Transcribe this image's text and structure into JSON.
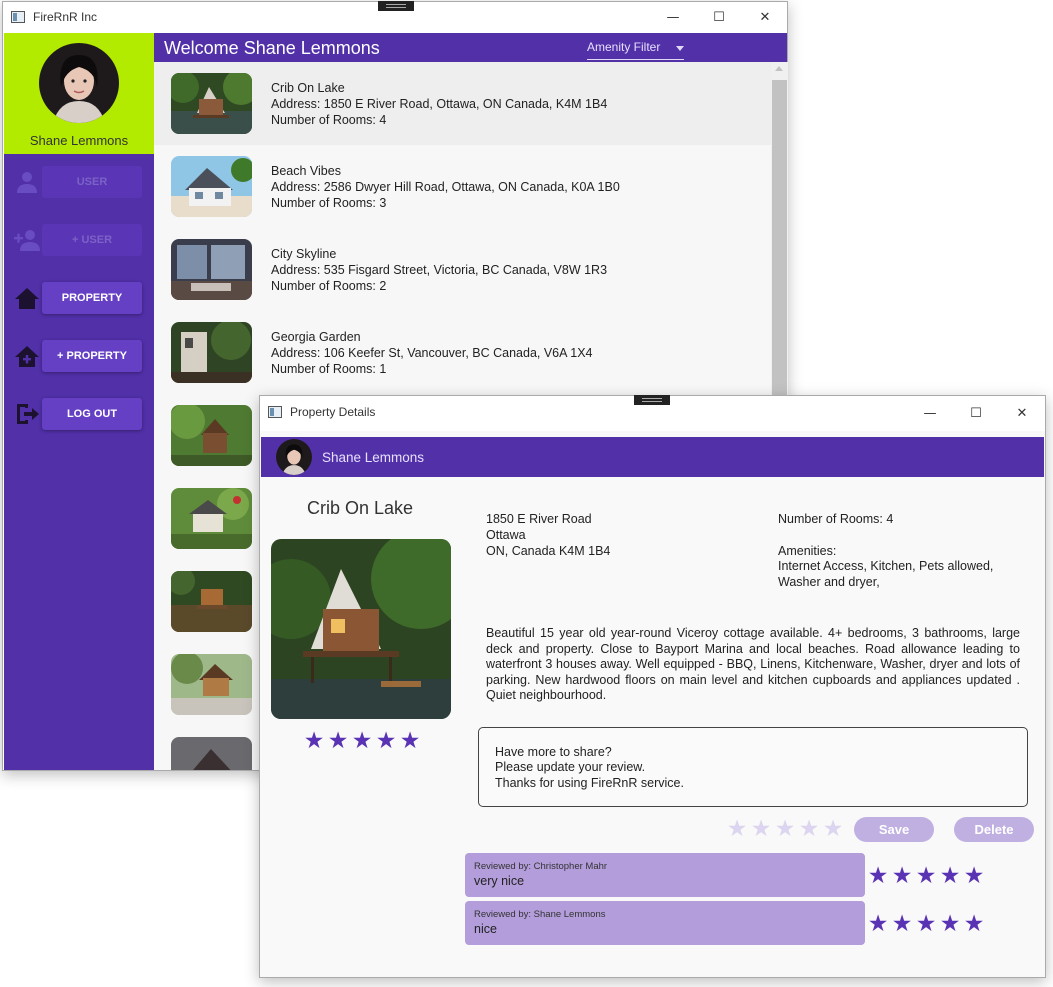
{
  "main_window": {
    "title": "FireRnR Inc",
    "welcome": "Welcome Shane Lemmons",
    "amenity_filter": {
      "selected": "Amenity Filter"
    }
  },
  "sidebar": {
    "user_name": "Shane Lemmons",
    "items": [
      {
        "label": "USER",
        "icon": "person-icon",
        "enabled": false
      },
      {
        "label": "+ USER",
        "icon": "add-person-icon",
        "enabled": false
      },
      {
        "label": "PROPERTY",
        "icon": "home-icon",
        "enabled": true
      },
      {
        "label": "+ PROPERTY",
        "icon": "add-home-icon",
        "enabled": true
      },
      {
        "label": "LOG OUT",
        "icon": "logout-icon",
        "enabled": true
      }
    ]
  },
  "properties": [
    {
      "name": "Crib On Lake",
      "address": "Address: 1850 E River Road, Ottawa, ON Canada, K4M 1B4",
      "rooms": "Number of Rooms: 4"
    },
    {
      "name": "Beach Vibes",
      "address": "Address: 2586  Dwyer Hill Road, Ottawa, ON Canada, K0A 1B0",
      "rooms": "Number of Rooms: 3"
    },
    {
      "name": "City Skyline",
      "address": "Address: 535  Fisgard Street, Victoria, BC Canada, V8W 1R3",
      "rooms": "Number of Rooms: 2"
    },
    {
      "name": "Georgia Garden",
      "address": "Address: 106 Keefer St, Vancouver, BC Canada, V6A 1X4",
      "rooms": "Number of Rooms: 1"
    }
  ],
  "details": {
    "window_title": "Property Details",
    "user_name": "Shane Lemmons",
    "property_name": "Crib On Lake",
    "property_rating": 5,
    "address_line1": "1850 E River Road",
    "address_line2": "Ottawa",
    "address_line3": "ON, Canada K4M 1B4",
    "rooms": "Number of Rooms: 4",
    "amenities_label": "Amenities:",
    "amenities_line1": "Internet Access, Kitchen, Pets allowed,",
    "amenities_line2": "Washer and dryer,",
    "description": "Beautiful 15 year old year-round Viceroy cottage available. 4+ bedrooms, 3 bathrooms, large deck and property. Close to Bayport Marina and local beaches. Road allowance leading to waterfront 3 houses away. Well equipped - BBQ, Linens, Kitchenware, Washer, dryer and lots of parking. New hardwood floors on main level and kitchen cupboards and appliances updated . Quiet neighbourhood.",
    "review_prompt_line1": "Have more to share?",
    "review_prompt_line2": "Please update your review.",
    "review_prompt_line3": "Thanks for using FireRnR service.",
    "my_rating": 0,
    "save_label": "Save",
    "delete_label": "Delete",
    "reviews": [
      {
        "by": "Reviewed by: Christopher Mahr",
        "text": "very nice",
        "rating": 5
      },
      {
        "by": "Reviewed by: Shane Lemmons",
        "text": "nice",
        "rating": 5
      }
    ]
  },
  "colors": {
    "primary": "#5130a8",
    "accent": "#b2ea00",
    "button": "#6540c4",
    "star": "#5a33b4",
    "review_bg": "#b39ddb"
  }
}
